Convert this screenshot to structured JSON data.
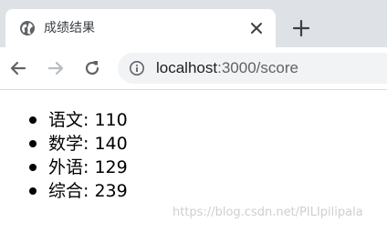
{
  "browser": {
    "tab": {
      "title": "成绩结果",
      "favicon": "globe-icon",
      "close_icon": "close-icon"
    },
    "new_tab_icon": "plus-icon",
    "nav": {
      "back_icon": "arrow-back-icon",
      "forward_icon": "arrow-forward-icon",
      "reload_icon": "reload-icon"
    },
    "address": {
      "info_icon": "info-icon",
      "host": "localhost",
      "rest": ":3000/score"
    }
  },
  "page": {
    "scores": [
      {
        "text": "语文: 110"
      },
      {
        "text": "数学: 140"
      },
      {
        "text": "外语: 129"
      },
      {
        "text": "综合: 239"
      }
    ]
  },
  "watermark": "https://blog.csdn.net/PILIpilipala",
  "colors": {
    "tabbar_bg": "#dee1e6",
    "omnibox_bg": "#f1f3f4",
    "icon": "#5f6368",
    "icon_disabled": "#b8bcc1"
  }
}
